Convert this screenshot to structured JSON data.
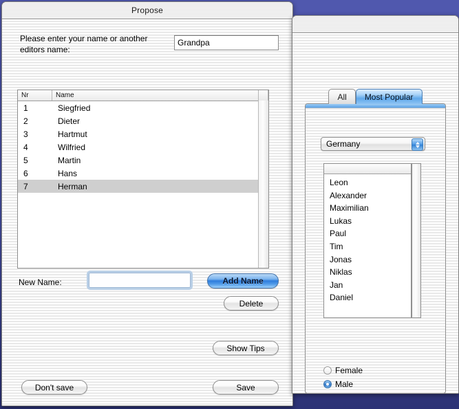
{
  "desktop": {
    "background_color": "#4f59ac"
  },
  "main_window": {
    "title": "Propose",
    "prompt_label": "Please enter your name or another editors name:",
    "editor_name_value": "Grandpa",
    "table": {
      "columns": [
        "Nr",
        "Name"
      ],
      "rows": [
        {
          "nr": "1",
          "name": "Siegfried",
          "selected": false
        },
        {
          "nr": "2",
          "name": "Dieter",
          "selected": false
        },
        {
          "nr": "3",
          "name": "Hartmut",
          "selected": false
        },
        {
          "nr": "4",
          "name": "Wilfried",
          "selected": false
        },
        {
          "nr": "5",
          "name": "Martin",
          "selected": false
        },
        {
          "nr": "6",
          "name": "Hans",
          "selected": false
        },
        {
          "nr": "7",
          "name": "Herman",
          "selected": true
        }
      ]
    },
    "new_name_label": "New Name:",
    "new_name_value": "",
    "new_name_placeholder": "",
    "add_name_label": "Add Name",
    "delete_label": "Delete",
    "show_tips_label": "Show Tips",
    "dont_save_label": "Don't save",
    "save_label": "Save"
  },
  "side_window": {
    "tabs": [
      {
        "label": "All",
        "active": false
      },
      {
        "label": "Most Popular",
        "active": true
      }
    ],
    "country_popup_value": "Germany",
    "names": [
      "Leon",
      "Alexander",
      "Maximilian",
      "Lukas",
      "Paul",
      "Tim",
      "Jonas",
      "Niklas",
      "Jan",
      "Daniel"
    ],
    "gender": {
      "female_label": "Female",
      "female_selected": false,
      "male_label": "Male",
      "male_selected": true
    }
  }
}
